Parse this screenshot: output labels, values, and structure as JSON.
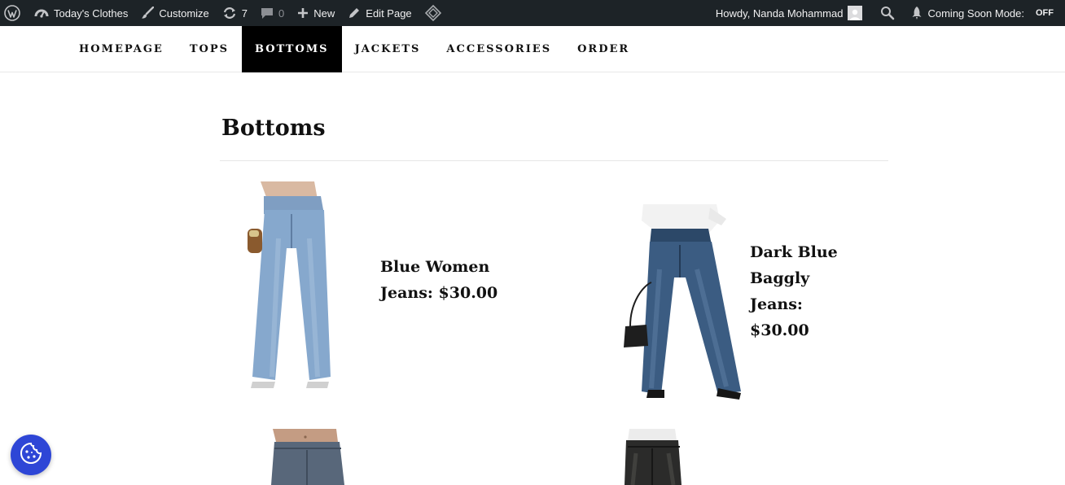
{
  "admin_bar": {
    "site_name": "Today's Clothes",
    "customize": "Customize",
    "updates_count": "7",
    "comments_count": "0",
    "new_label": "New",
    "edit_page": "Edit Page",
    "howdy": "Howdy, Nanda Mohammad",
    "coming_soon": "Coming Soon Mode:",
    "coming_soon_state": "OFF"
  },
  "nav": {
    "items": [
      {
        "label": "HOMEPAGE"
      },
      {
        "label": "TOPS"
      },
      {
        "label": "BOTTOMS",
        "active": true
      },
      {
        "label": "JACKETS"
      },
      {
        "label": "ACCESSORIES"
      },
      {
        "label": "ORDER"
      }
    ]
  },
  "page": {
    "title": "Bottoms"
  },
  "products": [
    {
      "name": "Blue Women Jeans: $30.00",
      "image": "light blue wide-leg jeans"
    },
    {
      "name": "Dark Blue Baggly Jeans: $30.00",
      "image": "dark blue wide-leg jeans"
    },
    {
      "name": "",
      "image": "mid-wash low-rise jeans"
    },
    {
      "name": "",
      "image": "black washed jeans"
    }
  ],
  "colors": {
    "admin_bar_bg": "#1d2327",
    "nav_active_bg": "#000000",
    "cookie_button": "#2e46d6"
  },
  "icons": {
    "wordpress": "wordpress-logo-icon",
    "dashboard": "dashboard-icon",
    "customize": "brush-icon",
    "updates": "refresh-icon",
    "comments": "comment-icon",
    "new": "plus-icon",
    "edit": "pencil-icon",
    "diamond": "diamond-icon",
    "search": "search-icon",
    "rocket": "rocket-icon",
    "cookie": "cookie-icon"
  }
}
